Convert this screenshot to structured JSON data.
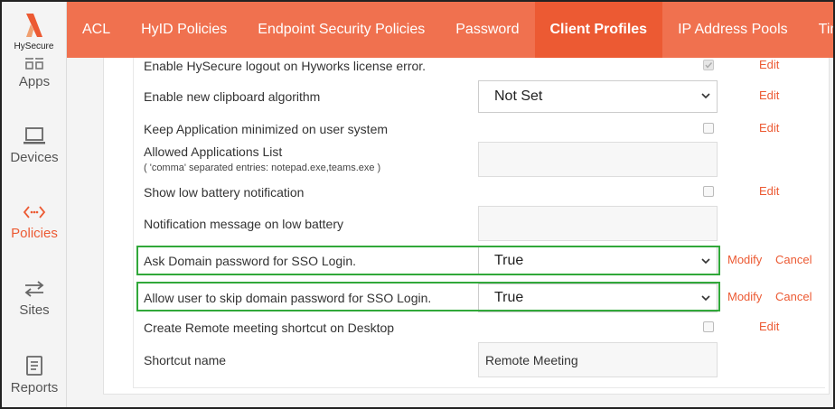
{
  "logo": {
    "text": "HySecure"
  },
  "tabs": [
    {
      "label": "ACL",
      "active": false
    },
    {
      "label": "HyID Policies",
      "active": false
    },
    {
      "label": "Endpoint Security Policies",
      "active": false
    },
    {
      "label": "Password",
      "active": false
    },
    {
      "label": "Client Profiles",
      "active": true
    },
    {
      "label": "IP Address Pools",
      "active": false
    },
    {
      "label": "Time Access Filter",
      "active": false
    }
  ],
  "sidebar": {
    "items": [
      {
        "label": "Apps",
        "icon": "grid-icon"
      },
      {
        "label": "Devices",
        "icon": "laptop-icon"
      },
      {
        "label": "Policies",
        "icon": "code-arrows-icon",
        "active": true
      },
      {
        "label": "Sites",
        "icon": "swap-arrows-icon"
      },
      {
        "label": "Reports",
        "icon": "report-icon"
      }
    ]
  },
  "settings": {
    "logout_license": {
      "label": "Enable HySecure logout on Hyworks license error.",
      "checked": true,
      "action": "Edit"
    },
    "clipboard": {
      "label": "Enable new clipboard algorithm",
      "value": "Not Set",
      "action": "Edit"
    },
    "keep_minimized": {
      "label": "Keep Application minimized on user system",
      "checked": false,
      "action": "Edit"
    },
    "allowed_apps": {
      "label": "Allowed Applications List",
      "hint": "( 'comma' separated entries: notepad.exe,teams.exe )",
      "value": ""
    },
    "low_battery": {
      "label": "Show low battery notification",
      "checked": false,
      "action": "Edit"
    },
    "battery_message": {
      "label": "Notification message on low battery",
      "value": ""
    },
    "ask_domain_pw": {
      "label": "Ask Domain password for SSO Login.",
      "value": "True",
      "modify": "Modify",
      "cancel": "Cancel"
    },
    "skip_domain_pw": {
      "label": "Allow user to skip domain password for SSO Login.",
      "value": "True",
      "modify": "Modify",
      "cancel": "Cancel"
    },
    "remote_shortcut": {
      "label": "Create Remote meeting shortcut on Desktop",
      "checked": false,
      "action": "Edit"
    },
    "shortcut_name": {
      "label": "Shortcut name",
      "value": "Remote Meeting"
    }
  },
  "colors": {
    "accent": "#ec5a33",
    "nav": "#f0714f",
    "highlight": "#31a83a"
  }
}
